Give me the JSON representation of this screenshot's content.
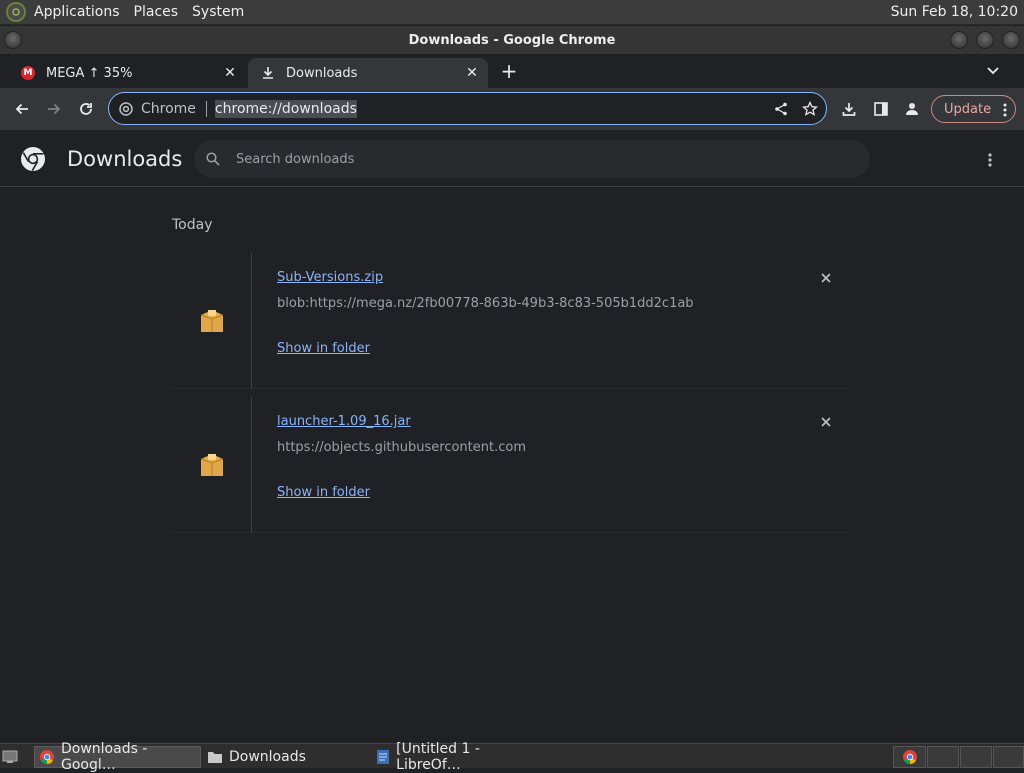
{
  "top_panel": {
    "menus": [
      "Applications",
      "Places",
      "System"
    ],
    "clock": "Sun Feb 18, 10:20"
  },
  "window": {
    "title": "Downloads - Google Chrome"
  },
  "tabs": [
    {
      "label": "MEGA ↑ 35%",
      "favicon": "mega-icon",
      "active": false
    },
    {
      "label": "Downloads",
      "favicon": "download-icon",
      "active": true
    }
  ],
  "toolbar": {
    "omnibox_chip": "Chrome",
    "url": "chrome://downloads",
    "update_label": "Update"
  },
  "downloads_page": {
    "title": "Downloads",
    "search_placeholder": "Search downloads",
    "section_label": "Today",
    "items": [
      {
        "filename": "Sub-Versions.zip",
        "source": "blob:https://mega.nz/2fb00778-863b-49b3-8c83-505b1dd2c1ab",
        "action": "Show in folder"
      },
      {
        "filename": "launcher-1.09_16.jar",
        "source": "https://objects.githubusercontent.com",
        "action": "Show in folder"
      }
    ]
  },
  "taskbar": {
    "items": [
      {
        "label": "Downloads - Googl…",
        "icon": "chrome-icon",
        "active": true
      },
      {
        "label": "Downloads",
        "icon": "folder-icon",
        "active": false
      },
      {
        "label": "[Untitled 1 - LibreOf…",
        "icon": "libreoffice-icon",
        "active": false
      }
    ]
  },
  "colors": {
    "accent": "#8ab4f8",
    "page_bg": "#202124",
    "toolbar_bg": "#35363a",
    "update": "#e8a9a3"
  }
}
